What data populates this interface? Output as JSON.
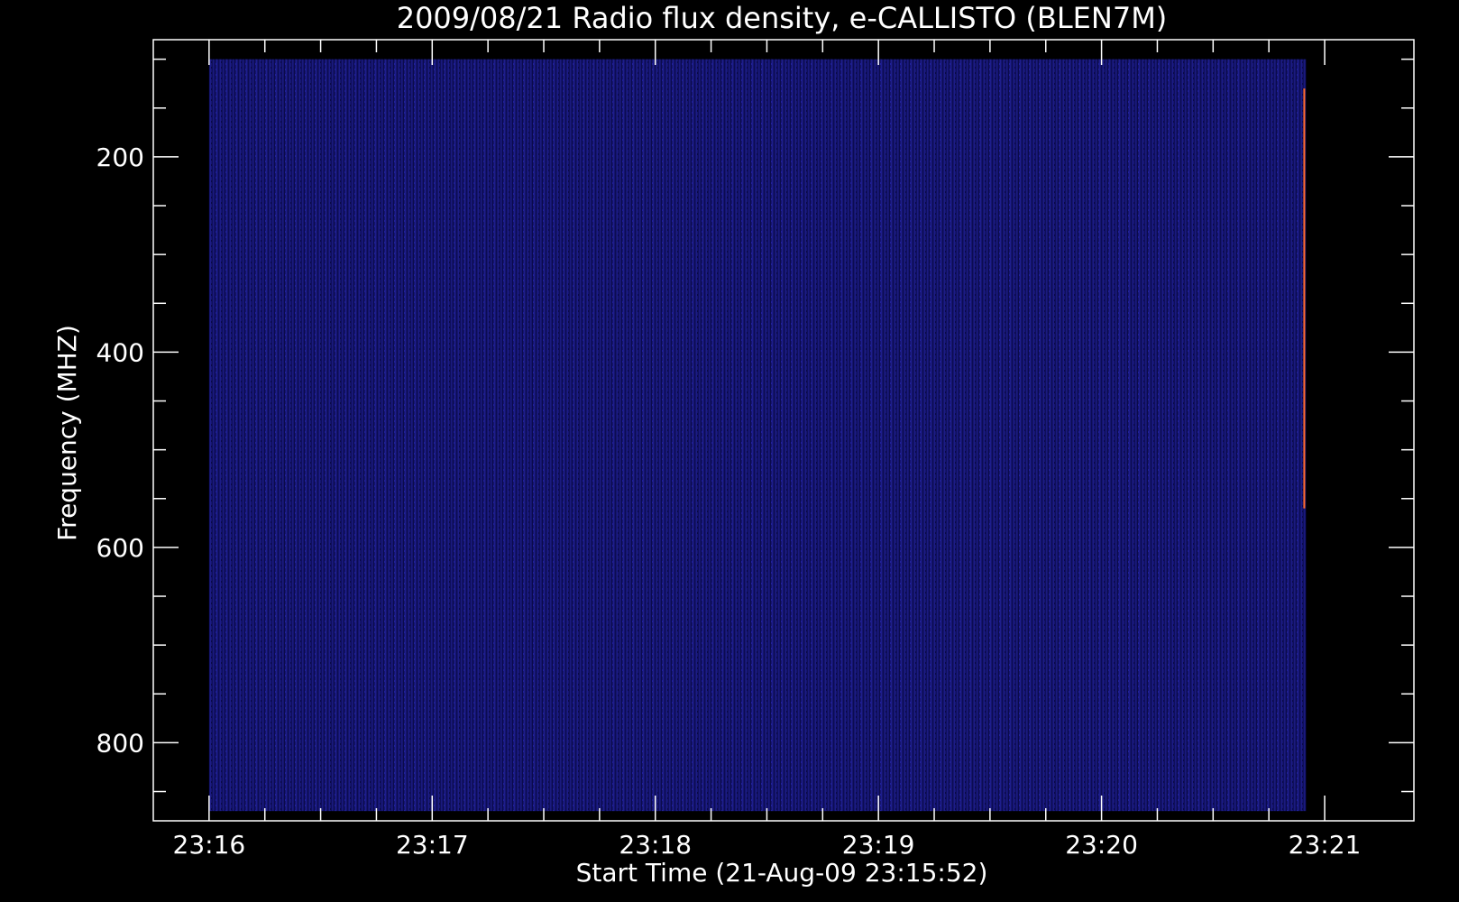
{
  "chart_data": {
    "type": "heatmap",
    "title": "2009/08/21  Radio flux density, e-CALLISTO (BLEN7M)",
    "xlabel": "Start Time (21-Aug-09 23:15:52)",
    "ylabel": "Frequency (MHZ)",
    "x_ticks": [
      "23:16",
      "23:17",
      "23:18",
      "23:19",
      "23:20",
      "23:21"
    ],
    "x_tick_seconds": [
      8,
      68,
      128,
      188,
      248,
      308
    ],
    "x_range_seconds": [
      -7,
      332
    ],
    "y_ticks": [
      200,
      400,
      600,
      800
    ],
    "y_range": [
      80,
      880
    ],
    "y_reversed": true,
    "y_minor_step": 50,
    "x_minor_per_major": 3,
    "data_extent": {
      "t_start_seconds": 8,
      "t_end_seconds": 303,
      "f_min": 100,
      "f_max": 870
    },
    "background_level": "uniform low flux (dark blue noise)",
    "burst": {
      "t_seconds": 303,
      "f_range": [
        130,
        560
      ],
      "note": "narrow bright vertical line at right edge"
    },
    "colors": {
      "background": "#000000",
      "axes": "#ffffff",
      "map_low": "#0c0c50",
      "map_mid": "#13146e",
      "burst": "#ff6a2a"
    }
  }
}
